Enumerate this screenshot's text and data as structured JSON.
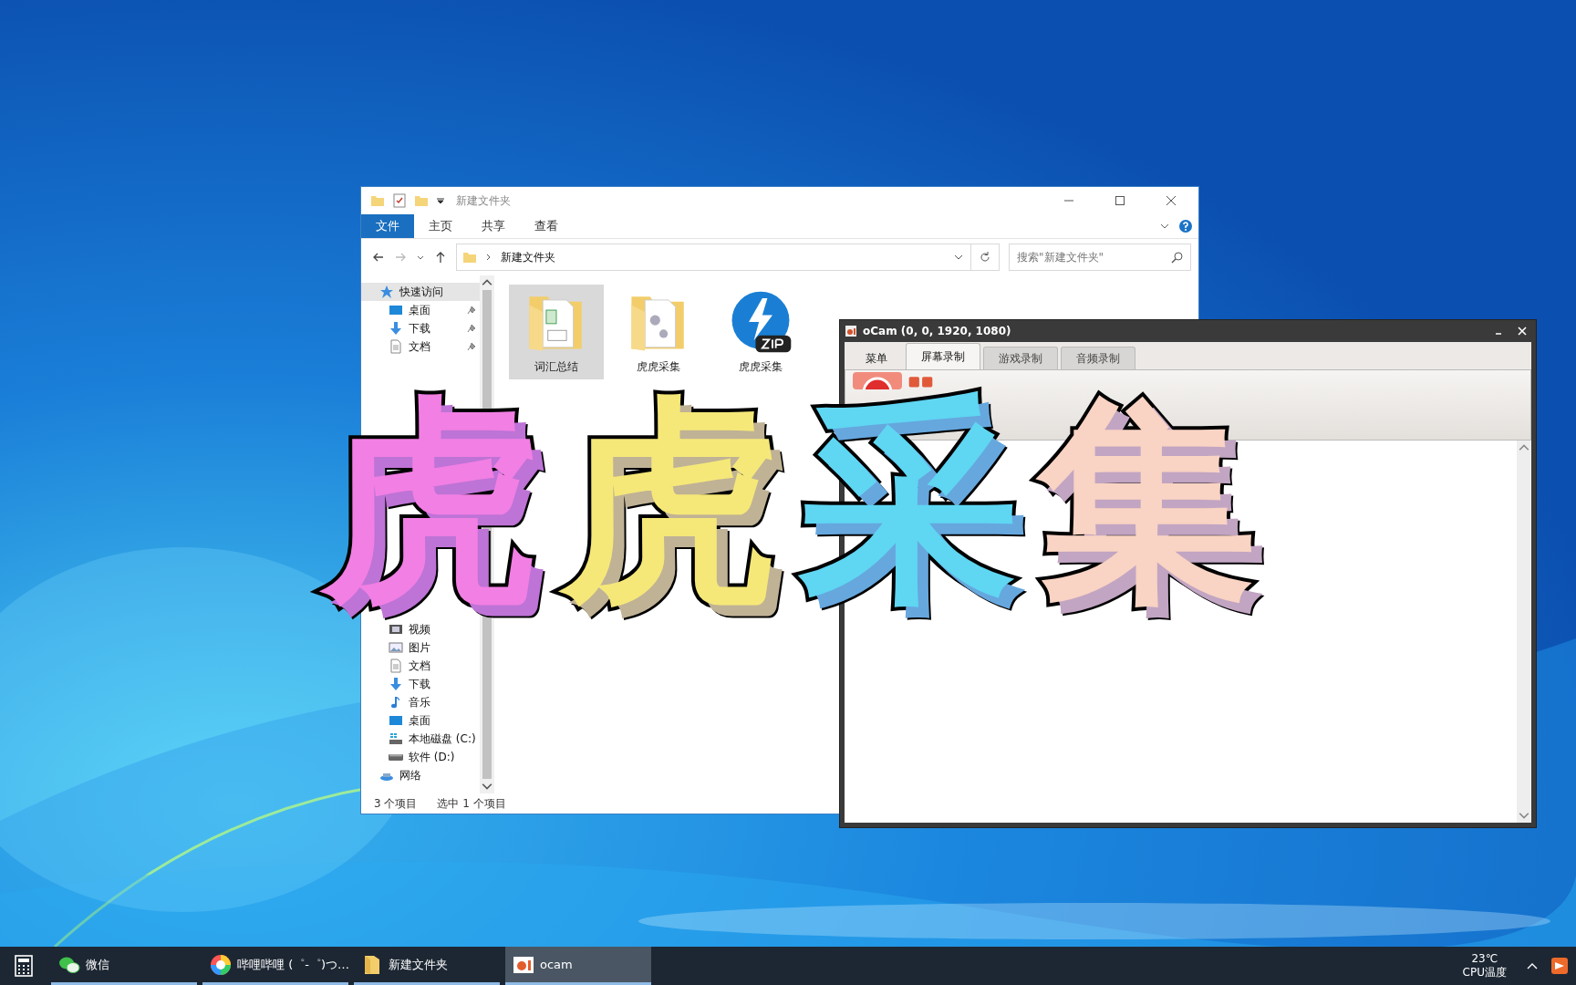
{
  "explorer": {
    "title": "新建文件夹",
    "ribbon_tabs": [
      {
        "label": "文件",
        "selected": true
      },
      {
        "label": "主页",
        "selected": false
      },
      {
        "label": "共享",
        "selected": false
      },
      {
        "label": "查看",
        "selected": false
      }
    ],
    "address": {
      "path": "新建文件夹"
    },
    "search": {
      "placeholder": "搜索\"新建文件夹\""
    },
    "nav_groups": [
      {
        "items": [
          {
            "label": "快速访问",
            "kind": "star",
            "selected": true,
            "pinned": false
          },
          {
            "label": "桌面",
            "kind": "desktop",
            "selected": false,
            "pinned": true
          },
          {
            "label": "下载",
            "kind": "download",
            "selected": false,
            "pinned": true
          },
          {
            "label": "文档",
            "kind": "doc",
            "selected": false,
            "pinned": true
          }
        ]
      },
      {
        "items": [
          {
            "label": "视频",
            "kind": "video",
            "selected": false,
            "pinned": false
          },
          {
            "label": "图片",
            "kind": "picture",
            "selected": false,
            "pinned": false
          },
          {
            "label": "文档",
            "kind": "doc",
            "selected": false,
            "pinned": false
          },
          {
            "label": "下载",
            "kind": "download",
            "selected": false,
            "pinned": false
          },
          {
            "label": "音乐",
            "kind": "music",
            "selected": false,
            "pinned": false
          },
          {
            "label": "桌面",
            "kind": "desktop",
            "selected": false,
            "pinned": false
          },
          {
            "label": "本地磁盘 (C:)",
            "kind": "system-drive",
            "selected": false,
            "pinned": false
          },
          {
            "label": "软件 (D:)",
            "kind": "drive",
            "selected": false,
            "pinned": false
          },
          {
            "label": "网络",
            "kind": "network",
            "selected": false,
            "pinned": false
          }
        ]
      }
    ],
    "files": [
      {
        "name": "词汇总结",
        "kind": "folder-sheet",
        "selected": true
      },
      {
        "name": "虎虎采集",
        "kind": "folder-gear",
        "selected": false
      },
      {
        "name": "虎虎采集",
        "kind": "zip",
        "selected": false
      }
    ],
    "status": {
      "count": "3 个项目",
      "selection": "选中 1 个项目"
    }
  },
  "ocam": {
    "title": "oCam (0, 0, 1920, 1080)",
    "tabs": [
      {
        "label": "菜单",
        "selected": false
      },
      {
        "label": "屏幕录制",
        "selected": true
      },
      {
        "label": "游戏录制",
        "selected": false
      },
      {
        "label": "音频录制",
        "selected": false
      }
    ]
  },
  "taskbar": {
    "items": [
      {
        "label": "微信",
        "kind": "wechat",
        "selected": false
      },
      {
        "label": "哔哩哔哩 (゜-゜)つ…",
        "kind": "bilibili",
        "selected": false
      },
      {
        "label": "新建文件夹",
        "kind": "folder",
        "selected": false
      },
      {
        "label": "ocam",
        "kind": "ocam",
        "selected": true
      }
    ],
    "temperature": "23℃",
    "temperature_label": "CPU温度"
  },
  "overlay_title": [
    {
      "text": "虎",
      "color": "#f27fe4"
    },
    {
      "text": "虎",
      "color": "#f5e878"
    },
    {
      "text": "采",
      "color": "#5fd6f2"
    },
    {
      "text": "集",
      "color": "#f9d3c3"
    }
  ]
}
